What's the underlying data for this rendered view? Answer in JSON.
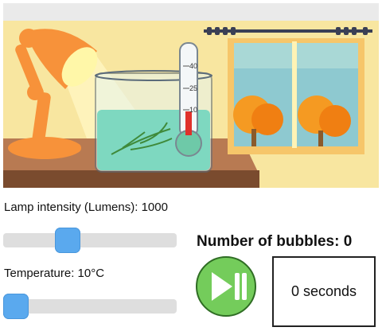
{
  "lamp": {
    "label": "Lamp intensity (Lumens): 1000",
    "slider_fraction": 0.35
  },
  "temperature": {
    "label": "Temperature: 10°C",
    "slider_fraction": 0.0
  },
  "bubbles": {
    "text": "Number of bubbles: 0"
  },
  "play_button": {
    "icon": "play-pause-icon"
  },
  "timer": {
    "text": "0 seconds"
  },
  "thermometer": {
    "ticks": [
      "40",
      "25",
      "10"
    ]
  },
  "colors": {
    "accent_green": "#74cc5b",
    "slider_thumb": "#5aa9ee",
    "lamp_orange": "#f7923a",
    "water": "#7ed8c0",
    "wall": "#f8e6a0"
  }
}
